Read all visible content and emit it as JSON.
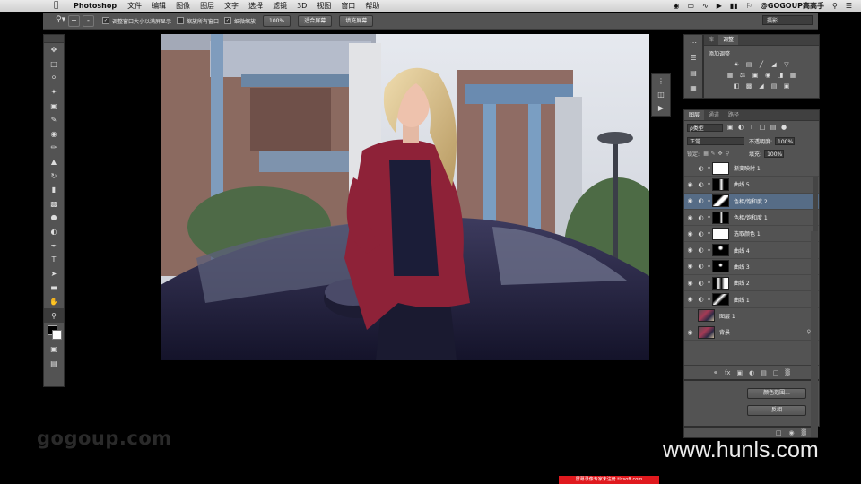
{
  "menubar": {
    "app_name": "Photoshop",
    "items": [
      "文件",
      "编辑",
      "图像",
      "图层",
      "文字",
      "选择",
      "滤镜",
      "3D",
      "视图",
      "窗口",
      "帮助"
    ],
    "user": "@GOGOUP高高手"
  },
  "options_bar": {
    "zoom_in": "+",
    "zoom_out": "-",
    "resize_windows_label": "调整窗口大小以满屏显示",
    "resize_windows_checked": true,
    "zoom_all_label": "缩放所有窗口",
    "zoom_all_checked": false,
    "scrubby_zoom_label": "细微缩放",
    "scrubby_zoom_checked": true,
    "btn_100": "100%",
    "btn_fit": "适合屏幕",
    "btn_fill": "填充屏幕",
    "workspace": "摄影"
  },
  "adjustments_panel": {
    "tabs": [
      "库",
      "调整"
    ],
    "active_tab": "调整",
    "title": "添加调整"
  },
  "layers_panel": {
    "tabs": [
      "图层",
      "通道",
      "路径"
    ],
    "kind_filter": "ρ类型",
    "blend_mode": "正常",
    "opacity_label": "不透明度:",
    "opacity_value": "100%",
    "lock_label": "锁定:",
    "fill_label": "填充:",
    "fill_value": "100%",
    "layers": [
      {
        "name": "渐变映射 1",
        "visible": false,
        "selected": false
      },
      {
        "name": "曲线 5",
        "visible": true,
        "selected": false
      },
      {
        "name": "色相/饱和度 2",
        "visible": true,
        "selected": true
      },
      {
        "name": "色相/饱和度 1",
        "visible": true,
        "selected": false
      },
      {
        "name": "选取颜色 1",
        "visible": true,
        "selected": false
      },
      {
        "name": "曲线 4",
        "visible": true,
        "selected": false
      },
      {
        "name": "曲线 3",
        "visible": true,
        "selected": false
      },
      {
        "name": "曲线 2",
        "visible": true,
        "selected": false
      },
      {
        "name": "曲线 1",
        "visible": true,
        "selected": false
      },
      {
        "name": "图层 1",
        "visible": false,
        "selected": false
      },
      {
        "name": "背景",
        "visible": true,
        "selected": false
      }
    ]
  },
  "actions_panel": {
    "btn_color_range": "颜色范围...",
    "btn_invert": "反相"
  },
  "watermarks": {
    "left": "gogoup.com",
    "right": "www.hunls.com",
    "red_bar": "屏幕录像专家未注册 tlxsoft.com"
  }
}
